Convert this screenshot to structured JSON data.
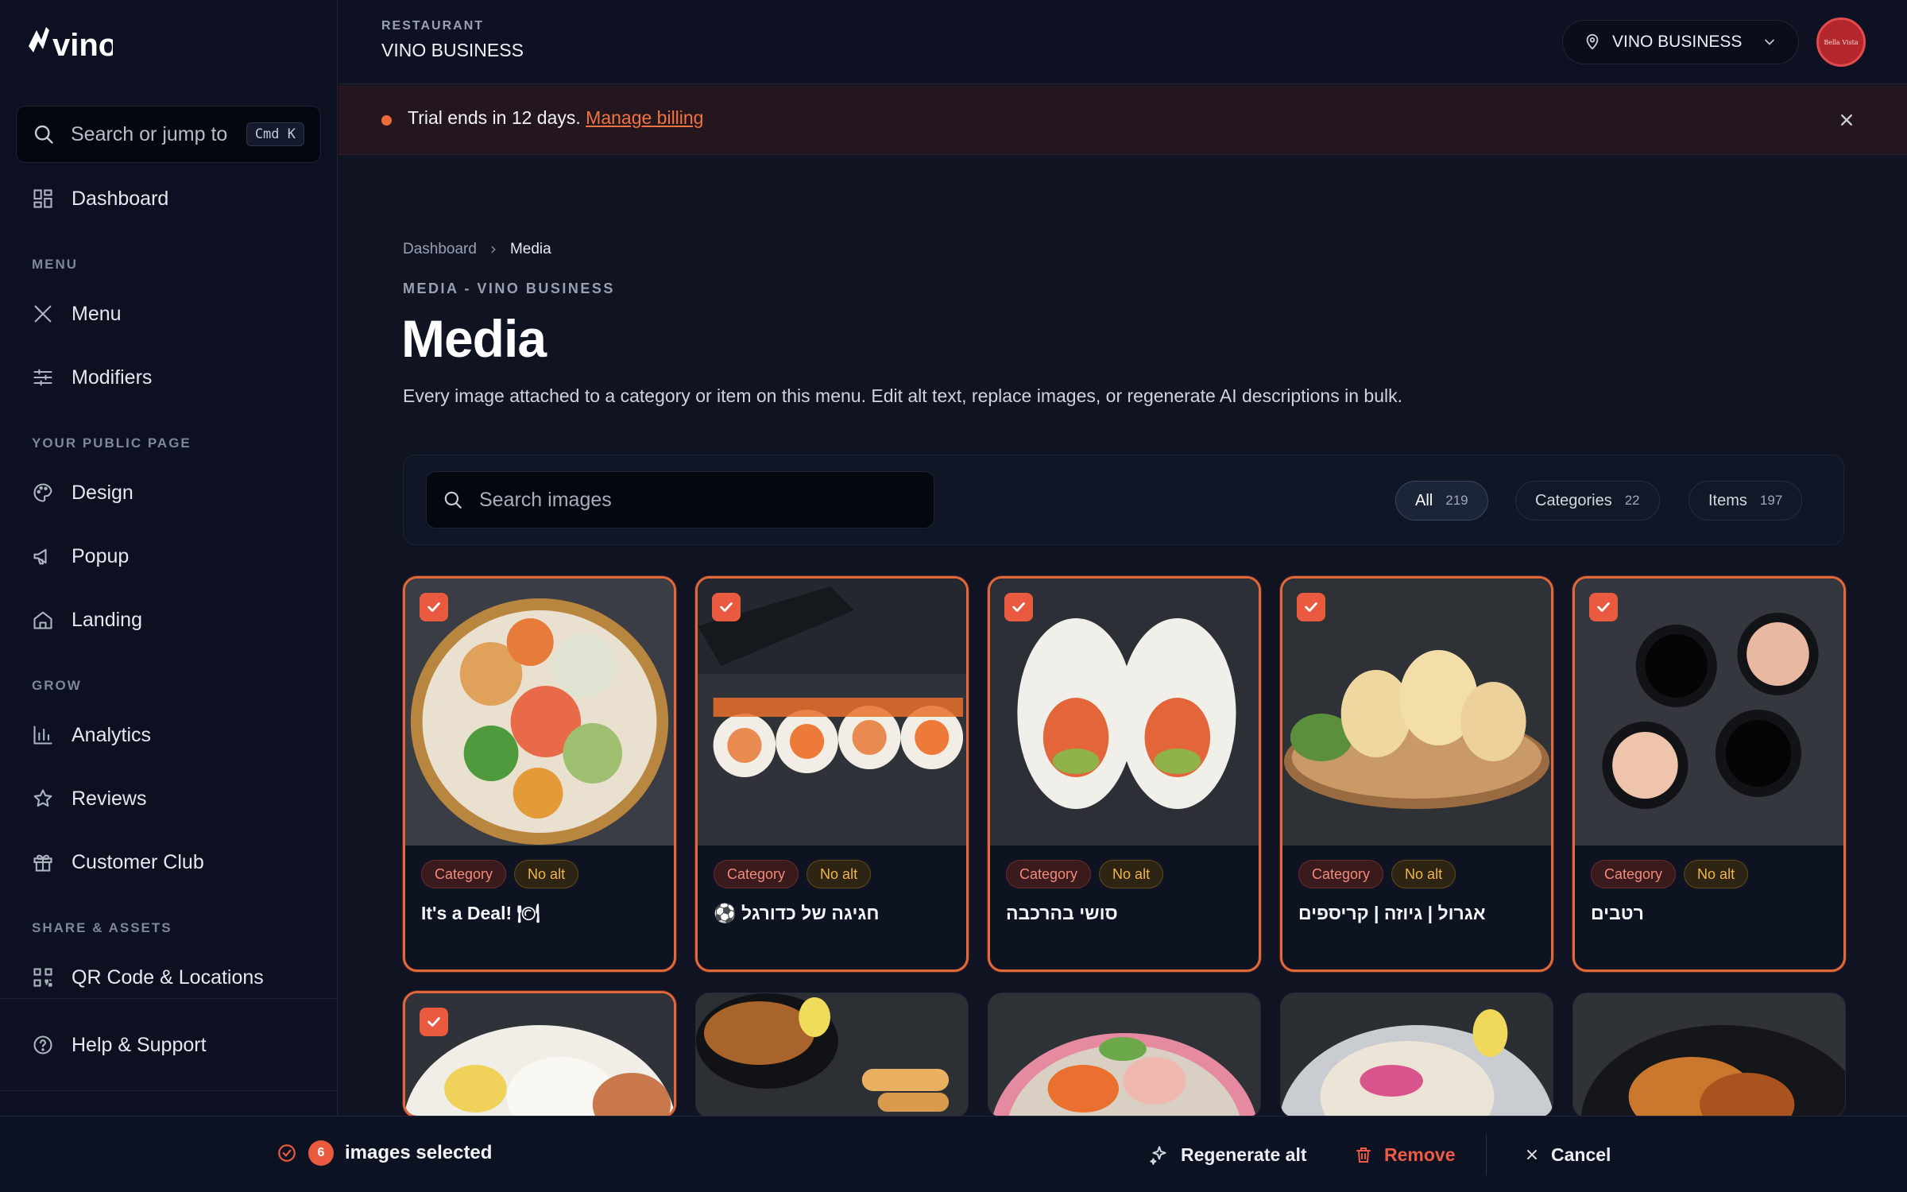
{
  "sidebar": {
    "brand": "vino",
    "search": {
      "placeholder": "Search or jump to",
      "shortcut": "Cmd K"
    },
    "items": [
      {
        "label": "Dashboard",
        "icon": "dashboard-icon"
      },
      {
        "label": "Menu",
        "icon": "utensils-icon"
      },
      {
        "label": "Modifiers",
        "icon": "sliders-icon"
      },
      {
        "label": "Design",
        "icon": "palette-icon"
      },
      {
        "label": "Popup",
        "icon": "megaphone-icon"
      },
      {
        "label": "Landing",
        "icon": "home-icon"
      },
      {
        "label": "Analytics",
        "icon": "bar-chart-icon"
      },
      {
        "label": "Reviews",
        "icon": "star-icon"
      },
      {
        "label": "Customer Club",
        "icon": "gift-icon"
      },
      {
        "label": "QR Code & Locations",
        "icon": "qr-code-icon"
      },
      {
        "label": "Help & Support",
        "icon": "help-circle-icon"
      }
    ],
    "sections": {
      "menu": "MENU",
      "public": "YOUR PUBLIC PAGE",
      "grow": "GROW",
      "share": "SHARE & ASSETS"
    }
  },
  "topbar": {
    "caption": "RESTAURANT",
    "restaurant": "VINO BUSINESS",
    "location_selector": "VINO BUSINESS",
    "avatar_text": "Bella Vista"
  },
  "banner": {
    "text": "Trial ends in 12 days.",
    "link": "Manage billing"
  },
  "breadcrumb": {
    "root": "Dashboard",
    "current": "Media"
  },
  "page": {
    "eyebrow": "MEDIA - VINO BUSINESS",
    "title": "Media",
    "subtitle": "Every image attached to a category or item on this menu. Edit alt text, replace images, or regenerate AI descriptions in bulk."
  },
  "filters": {
    "search_placeholder": "Search images",
    "tabs": [
      {
        "label": "All",
        "count": "219",
        "active": true
      },
      {
        "label": "Categories",
        "count": "22",
        "active": false
      },
      {
        "label": "Items",
        "count": "197",
        "active": false
      }
    ]
  },
  "cards": [
    {
      "title": "It's a Deal! 🍽",
      "type": "Category",
      "alt": "No alt",
      "selected": true,
      "rtl": false
    },
    {
      "title": "חגיגה של כדורגל ⚽",
      "type": "Category",
      "alt": "No alt",
      "selected": true,
      "rtl": true
    },
    {
      "title": "סושי בהרכבה",
      "type": "Category",
      "alt": "No alt",
      "selected": true,
      "rtl": true
    },
    {
      "title": "אגרול | גיוזה | קריספים",
      "type": "Category",
      "alt": "No alt",
      "selected": true,
      "rtl": true
    },
    {
      "title": "רטבים",
      "type": "Category",
      "alt": "No alt",
      "selected": true,
      "rtl": true
    }
  ],
  "row2": [
    {
      "selected": true
    },
    {
      "selected": false
    },
    {
      "selected": false
    },
    {
      "selected": false
    },
    {
      "selected": false
    }
  ],
  "selection_bar": {
    "count": "6",
    "text": "images selected",
    "regenerate": "Regenerate alt",
    "remove": "Remove",
    "cancel": "Cancel"
  },
  "colors": {
    "accent": "#ea5a3f",
    "link": "#f0743f",
    "warning": "#f0b54b"
  }
}
